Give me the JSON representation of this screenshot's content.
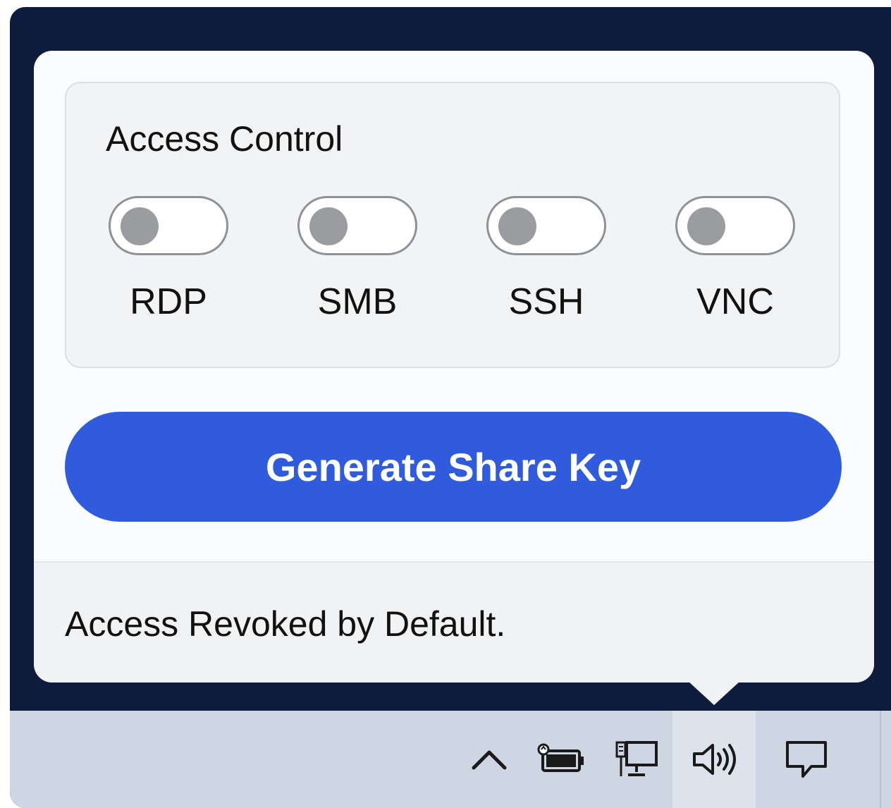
{
  "popup": {
    "title": "Access Control",
    "toggles": [
      {
        "label": "RDP",
        "on": false
      },
      {
        "label": "SMB",
        "on": false
      },
      {
        "label": "SSH",
        "on": false
      },
      {
        "label": "VNC",
        "on": false
      }
    ],
    "primary_button": "Generate Share Key",
    "footer_text": "Access Revoked by Default."
  },
  "taskbar": {
    "icons": [
      "chevron-up-icon",
      "battery-icon",
      "network-icon",
      "volume-icon",
      "notifications-icon"
    ]
  },
  "colors": {
    "accent": "#2f5bdc",
    "frame": "#0d1b3d",
    "taskbar": "#cfd6e3"
  }
}
